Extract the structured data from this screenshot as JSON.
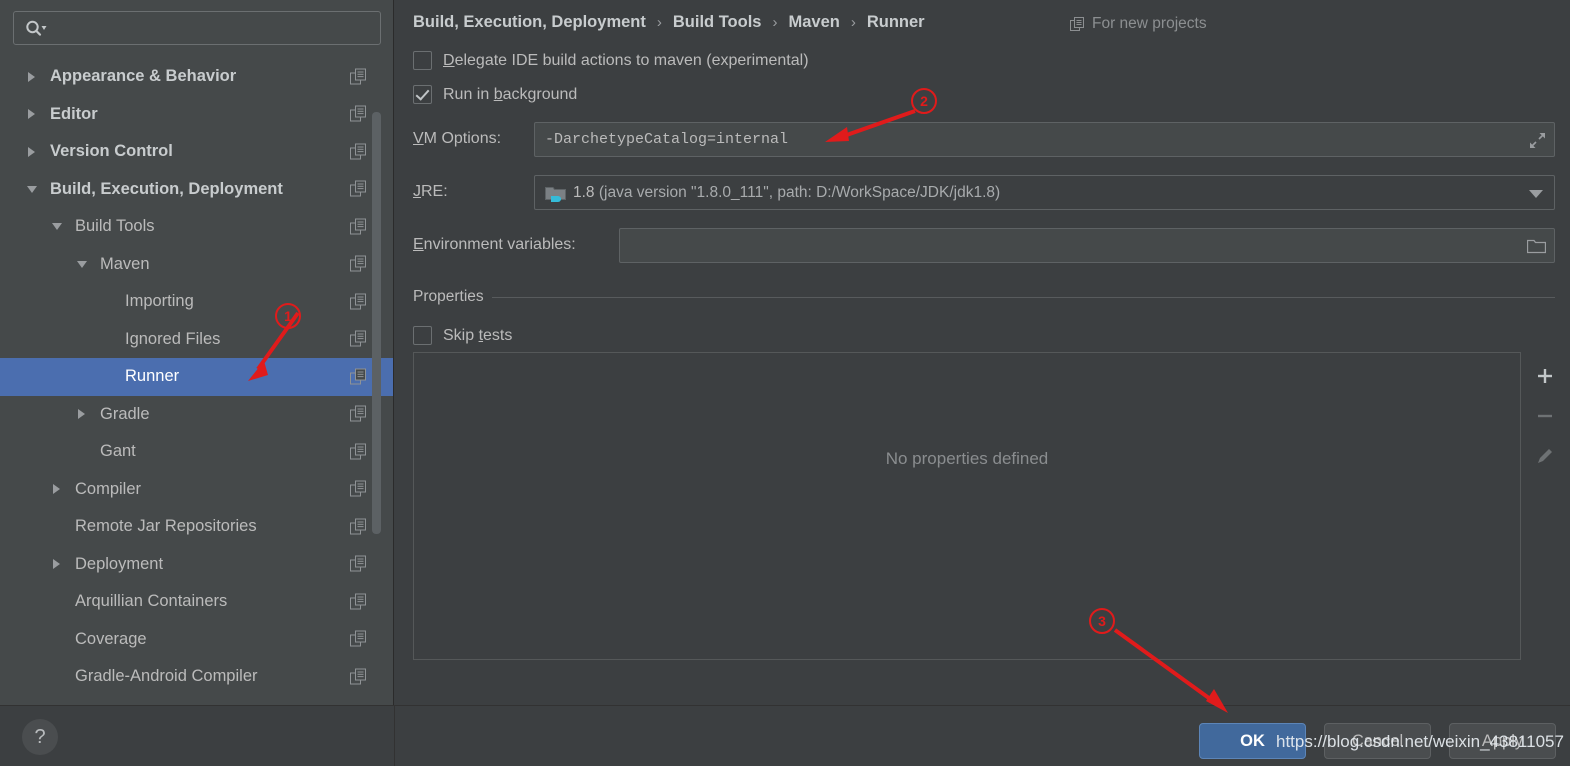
{
  "search": {
    "placeholder": "",
    "value": "",
    "icon": "search-icon"
  },
  "sidebar": {
    "items": [
      {
        "label": "Appearance & Behavior",
        "indent": 20,
        "twisty": "right",
        "bold": true,
        "selected": false
      },
      {
        "label": "Editor",
        "indent": 20,
        "twisty": "right",
        "bold": true,
        "selected": false
      },
      {
        "label": "Version Control",
        "indent": 20,
        "twisty": "right",
        "bold": true,
        "selected": false
      },
      {
        "label": "Build, Execution, Deployment",
        "indent": 20,
        "twisty": "down",
        "bold": true,
        "selected": false
      },
      {
        "label": "Build Tools",
        "indent": 45,
        "twisty": "down",
        "bold": false,
        "selected": false
      },
      {
        "label": "Maven",
        "indent": 70,
        "twisty": "down",
        "bold": false,
        "selected": false
      },
      {
        "label": "Importing",
        "indent": 95,
        "twisty": "none",
        "bold": false,
        "selected": false
      },
      {
        "label": "Ignored Files",
        "indent": 95,
        "twisty": "none",
        "bold": false,
        "selected": false
      },
      {
        "label": "Runner",
        "indent": 95,
        "twisty": "none",
        "bold": false,
        "selected": true
      },
      {
        "label": "Gradle",
        "indent": 70,
        "twisty": "right",
        "bold": false,
        "selected": false
      },
      {
        "label": "Gant",
        "indent": 70,
        "twisty": "none",
        "bold": false,
        "selected": false
      },
      {
        "label": "Compiler",
        "indent": 45,
        "twisty": "right",
        "bold": false,
        "selected": false
      },
      {
        "label": "Remote Jar Repositories",
        "indent": 45,
        "twisty": "none",
        "bold": false,
        "selected": false
      },
      {
        "label": "Deployment",
        "indent": 45,
        "twisty": "right",
        "bold": false,
        "selected": false
      },
      {
        "label": "Arquillian Containers",
        "indent": 45,
        "twisty": "none",
        "bold": false,
        "selected": false
      },
      {
        "label": "Coverage",
        "indent": 45,
        "twisty": "none",
        "bold": false,
        "selected": false
      },
      {
        "label": "Gradle-Android Compiler",
        "indent": 45,
        "twisty": "none",
        "bold": false,
        "selected": false
      }
    ]
  },
  "breadcrumb": {
    "parts": [
      "Build, Execution, Deployment",
      "Build Tools",
      "Maven",
      "Runner"
    ],
    "separator": "›",
    "for_new_projects": "For new projects"
  },
  "main": {
    "delegate_checkbox": {
      "label_pre": "",
      "mnemonic": "D",
      "label_post": "elegate IDE build actions to maven (experimental)",
      "checked": false
    },
    "run_background_checkbox": {
      "label_pre": "Run in ",
      "mnemonic": "b",
      "label_post": "ackground",
      "checked": true
    },
    "vm_options": {
      "label_pre": "",
      "mnemonic": "V",
      "label_post": "M Options:",
      "value": "-DarchetypeCatalog=internal",
      "expand_icon": "expand-icon"
    },
    "jre": {
      "label_pre": "",
      "mnemonic": "J",
      "label_post": "RE:",
      "version": "1.8",
      "detail": "(java version \"1.8.0_111\", path: D:/WorkSpace/JDK/jdk1.8)",
      "icon": "jdk-folder-icon"
    },
    "env_variables": {
      "label_pre": "",
      "mnemonic": "E",
      "label_post": "nvironment variables:",
      "value": "",
      "browse_icon": "folder-icon"
    },
    "properties": {
      "legend": "Properties",
      "skip_tests": {
        "label_pre": "Skip ",
        "mnemonic": "t",
        "label_post": "ests",
        "checked": false
      },
      "empty_text": "No properties defined",
      "toolbar": [
        {
          "name": "add",
          "glyph": "+"
        },
        {
          "name": "remove",
          "glyph": "−"
        },
        {
          "name": "edit",
          "glyph": "pencil"
        }
      ]
    }
  },
  "footer": {
    "help": "?",
    "ok": "OK",
    "cancel": "Cancel",
    "apply": "Apply"
  },
  "watermark": "https://blog.csdn.net/weixin_43811057",
  "annotations": [
    {
      "id": "1",
      "number": "①"
    },
    {
      "id": "2",
      "number": "②"
    },
    {
      "id": "3",
      "number": "③"
    }
  ],
  "colors": {
    "panel_bg": "#3c3f41",
    "sidebar_bg": "#45494a",
    "selection_blue": "#4b6eaf",
    "ok_blue": "#41699c",
    "annotation_red": "#e01b1b",
    "text": "#bbbbbb"
  }
}
